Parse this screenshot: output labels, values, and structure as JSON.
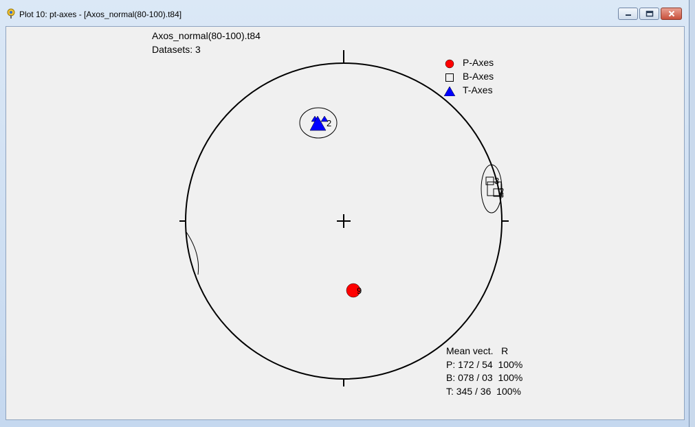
{
  "window": {
    "title": "Plot 10: pt-axes - [Axos_normal(80-100).t84]",
    "buttons": [
      "minimize",
      "maximize",
      "close"
    ]
  },
  "header": {
    "filename": "Axos_normal(80-100).t84",
    "datasets": "Datasets: 3"
  },
  "legend": [
    {
      "label": "P-Axes",
      "symbol": "filled-circle",
      "color": "#ff0000"
    },
    {
      "label": "B-Axes",
      "symbol": "open-square",
      "color": "#000000"
    },
    {
      "label": "T-Axes",
      "symbol": "filled-triangle",
      "color": "#0000ff"
    }
  ],
  "stats": {
    "header": "Mean vect.   R",
    "rows": [
      "P: 172 / 54  100%",
      "B: 078 / 03  100%",
      "T: 345 / 36  100%"
    ]
  },
  "marker_labels": {
    "t": "2",
    "b_top": "3",
    "b_mid": "2",
    "b_bot": "4",
    "p": "9"
  }
}
